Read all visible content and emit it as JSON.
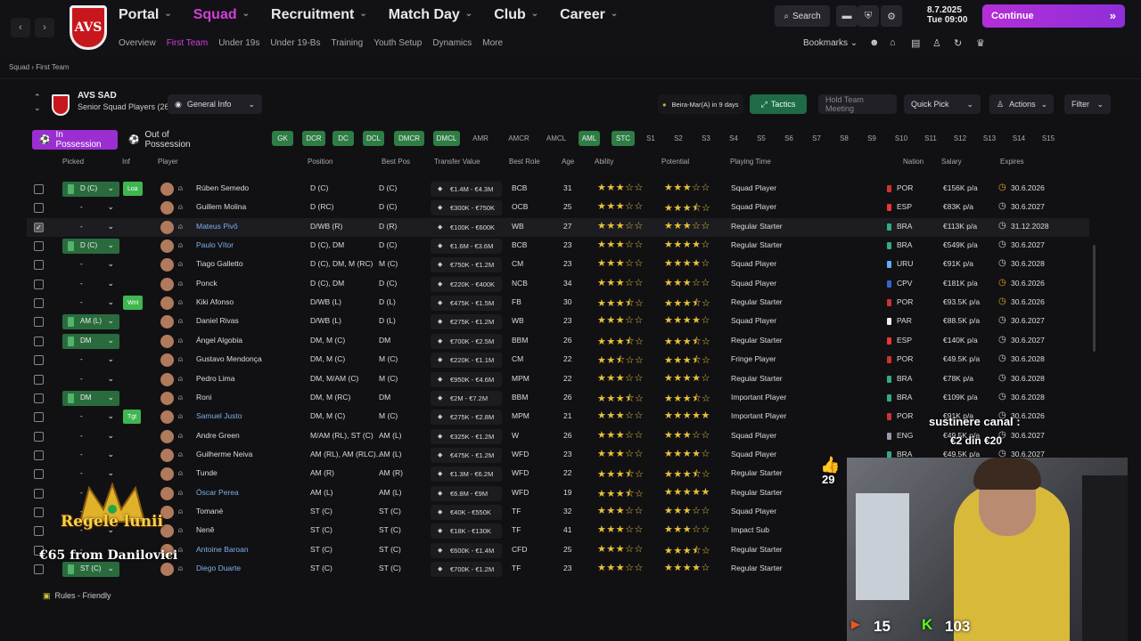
{
  "nav": {
    "back": "‹",
    "forward": "›",
    "crest": "AVS",
    "items": [
      "Portal",
      "Squad",
      "Recruitment",
      "Match Day",
      "Club",
      "Career"
    ],
    "active": "Squad",
    "sub": [
      "Overview",
      "First Team",
      "Under 19s",
      "Under 19-Bs",
      "Training",
      "Youth Setup",
      "Dynamics",
      "More"
    ],
    "sub_active": "First Team"
  },
  "topbar": {
    "search": "Search",
    "date_line1": "8.7.2025",
    "date_line2": "Tue 09:00",
    "continue": "Continue",
    "bookmarks": "Bookmarks"
  },
  "breadcrumb": "Squad › First Team",
  "club": {
    "name": "AVS SAD",
    "subtitle": "Senior Squad Players (26)",
    "view": "General Info",
    "next_match": "Beira-Mar(A) in 9 days",
    "tactics": "Tactics",
    "meeting": "Hold Team Meeting",
    "quick_pick": "Quick Pick",
    "actions": "Actions",
    "filter": "Filter"
  },
  "tabs": {
    "in": "In Possession",
    "out": "Out of Possession"
  },
  "positions": [
    {
      "l": "GK",
      "on": true
    },
    {
      "l": "DCR",
      "on": true
    },
    {
      "l": "DC",
      "on": true
    },
    {
      "l": "DCL",
      "on": true
    },
    {
      "l": "DMCR",
      "on": true
    },
    {
      "l": "DMCL",
      "on": true
    },
    {
      "l": "AMR",
      "on": false
    },
    {
      "l": "AMCR",
      "on": false
    },
    {
      "l": "AMCL",
      "on": false
    },
    {
      "l": "AML",
      "on": true
    },
    {
      "l": "STC",
      "on": true
    },
    {
      "l": "S1",
      "on": false
    },
    {
      "l": "S2",
      "on": false
    },
    {
      "l": "S3",
      "on": false
    },
    {
      "l": "S4",
      "on": false
    },
    {
      "l": "S5",
      "on": false
    },
    {
      "l": "S6",
      "on": false
    },
    {
      "l": "S7",
      "on": false
    },
    {
      "l": "S8",
      "on": false
    },
    {
      "l": "S9",
      "on": false
    },
    {
      "l": "S10",
      "on": false
    },
    {
      "l": "S11",
      "on": false
    },
    {
      "l": "S12",
      "on": false
    },
    {
      "l": "S13",
      "on": false
    },
    {
      "l": "S14",
      "on": false
    },
    {
      "l": "S15",
      "on": false
    }
  ],
  "columns": [
    "Picked",
    "Inf",
    "Player",
    "Position",
    "Best Pos",
    "Transfer Value",
    "Best Role",
    "Age",
    "Ability",
    "Potential",
    "Playing Time",
    "Nation",
    "Salary",
    "Expires"
  ],
  "rows": [
    {
      "pick": "D (C)",
      "inf": "Loa",
      "name": "Rúben Semedo",
      "pos": "D (C)",
      "best": "D (C)",
      "tv": "€1.4M - €4.3M",
      "role": "BCB",
      "age": "31",
      "ab": 3,
      "pot": 3,
      "pt": "Squad Player",
      "nat": "POR",
      "nc": "#c33",
      "sal": "€156K p/a",
      "exp": "30.6.2026",
      "ec": "#e0a020",
      "link": false
    },
    {
      "pick": "-",
      "inf": "",
      "name": "Guillem Molina",
      "pos": "D (RC)",
      "best": "D (C)",
      "tv": "€300K - €750K",
      "role": "OCB",
      "age": "25",
      "ab": 3,
      "pot": 3.5,
      "pt": "Squad Player",
      "nat": "ESP",
      "nc": "#e33",
      "sal": "€83K p/a",
      "exp": "30.6.2027",
      "ec": "#ccc",
      "link": false
    },
    {
      "pick": "-",
      "inf": "",
      "name": "Mateus Pivô",
      "pos": "D/WB (R)",
      "best": "D (R)",
      "tv": "€100K - €600K",
      "role": "WB",
      "age": "27",
      "ab": 3,
      "pot": 3,
      "pt": "Regular Starter",
      "nat": "BRA",
      "nc": "#3a8",
      "sal": "€113K p/a",
      "exp": "31.12.2028",
      "ec": "#ccc",
      "link": true,
      "sel": true
    },
    {
      "pick": "D (C)",
      "inf": "",
      "name": "Paulo Vítor",
      "pos": "D (C), DM",
      "best": "D (C)",
      "tv": "€1.6M - €3.6M",
      "role": "BCB",
      "age": "23",
      "ab": 3,
      "pot": 4,
      "pt": "Regular Starter",
      "nat": "BRA",
      "nc": "#3a8",
      "sal": "€549K p/a",
      "exp": "30.6.2027",
      "ec": "#ccc",
      "link": true
    },
    {
      "pick": "-",
      "inf": "",
      "name": "Tiago Galletto",
      "pos": "D (C), DM, M (RC)",
      "best": "M (C)",
      "tv": "€750K - €1.2M",
      "role": "CM",
      "age": "23",
      "ab": 3,
      "pot": 4,
      "pt": "Squad Player",
      "nat": "URU",
      "nc": "#6af",
      "sal": "€91K p/a",
      "exp": "30.6.2028",
      "ec": "#ccc",
      "link": false
    },
    {
      "pick": "-",
      "inf": "",
      "name": "Ponck",
      "pos": "D (C), DM",
      "best": "D (C)",
      "tv": "€220K - €400K",
      "role": "NCB",
      "age": "34",
      "ab": 3,
      "pot": 3,
      "pt": "Squad Player",
      "nat": "CPV",
      "nc": "#36c",
      "sal": "€181K p/a",
      "exp": "30.6.2026",
      "ec": "#e0a020",
      "link": false
    },
    {
      "pick": "-",
      "inf": "Wnt",
      "name": "Kiki Afonso",
      "pos": "D/WB (L)",
      "best": "D (L)",
      "tv": "€475K - €1.5M",
      "role": "FB",
      "age": "30",
      "ab": 3.5,
      "pot": 3.5,
      "pt": "Regular Starter",
      "nat": "POR",
      "nc": "#c33",
      "sal": "€93.5K p/a",
      "exp": "30.6.2026",
      "ec": "#e0a020",
      "link": false
    },
    {
      "pick": "AM (L)",
      "inf": "",
      "name": "Daniel Rivas",
      "pos": "D/WB (L)",
      "best": "D (L)",
      "tv": "€275K - €1.2M",
      "role": "WB",
      "age": "23",
      "ab": 3,
      "pot": 4,
      "pt": "Squad Player",
      "nat": "PAR",
      "nc": "#eee",
      "sal": "€88.5K p/a",
      "exp": "30.6.2027",
      "ec": "#ccc",
      "link": false
    },
    {
      "pick": "DM",
      "inf": "",
      "name": "Ángel Algobia",
      "pos": "DM, M (C)",
      "best": "DM",
      "tv": "€700K - €2.5M",
      "role": "BBM",
      "age": "26",
      "ab": 3.5,
      "pot": 3.5,
      "pt": "Regular Starter",
      "nat": "ESP",
      "nc": "#e33",
      "sal": "€140K p/a",
      "exp": "30.6.2027",
      "ec": "#ccc",
      "link": false
    },
    {
      "pick": "-",
      "inf": "",
      "name": "Gustavo Mendonça",
      "pos": "DM, M (C)",
      "best": "M (C)",
      "tv": "€220K - €1.1M",
      "role": "CM",
      "age": "22",
      "ab": 2.5,
      "pot": 3.5,
      "pt": "Fringe Player",
      "nat": "POR",
      "nc": "#c33",
      "sal": "€49.5K p/a",
      "exp": "30.6.2028",
      "ec": "#ccc",
      "link": false
    },
    {
      "pick": "-",
      "inf": "",
      "name": "Pedro Lima",
      "pos": "DM, M/AM (C)",
      "best": "M (C)",
      "tv": "€950K - €4.6M",
      "role": "MPM",
      "age": "22",
      "ab": 3,
      "pot": 4,
      "pt": "Regular Starter",
      "nat": "BRA",
      "nc": "#3a8",
      "sal": "€78K p/a",
      "exp": "30.6.2028",
      "ec": "#ccc",
      "link": false
    },
    {
      "pick": "DM",
      "inf": "",
      "name": "Roni",
      "pos": "DM, M (RC)",
      "best": "DM",
      "tv": "€2M - €7.2M",
      "role": "BBM",
      "age": "26",
      "ab": 3.5,
      "pot": 3.5,
      "pt": "Important Player",
      "nat": "BRA",
      "nc": "#3a8",
      "sal": "€109K p/a",
      "exp": "30.6.2028",
      "ec": "#ccc",
      "link": false
    },
    {
      "pick": "-",
      "inf": "Tgt",
      "name": "Samuel Justo",
      "pos": "DM, M (C)",
      "best": "M (C)",
      "tv": "€275K - €2.8M",
      "role": "MPM",
      "age": "21",
      "ab": 3,
      "pot": 5,
      "pt": "Important Player",
      "nat": "POR",
      "nc": "#c33",
      "sal": "€91K p/a",
      "exp": "30.6.2026",
      "ec": "#ccc",
      "link": true
    },
    {
      "pick": "-",
      "inf": "",
      "name": "Andre Green",
      "pos": "M/AM (RL), ST (C)",
      "best": "AM (L)",
      "tv": "€325K - €1.2M",
      "role": "W",
      "age": "26",
      "ab": 3,
      "pot": 3,
      "pt": "Squad Player",
      "nat": "ENG",
      "nc": "#99a",
      "sal": "€49.5K p/a",
      "exp": "30.6.2027",
      "ec": "#ccc",
      "link": false
    },
    {
      "pick": "-",
      "inf": "",
      "name": "Guilherme Neiva",
      "pos": "AM (RL), AM (RLC)...",
      "best": "AM (L)",
      "tv": "€475K - €1.2M",
      "role": "WFD",
      "age": "23",
      "ab": 3,
      "pot": 4,
      "pt": "Squad Player",
      "nat": "BRA",
      "nc": "#3a8",
      "sal": "€49.5K p/a",
      "exp": "30.6.2027",
      "ec": "#ccc",
      "link": false
    },
    {
      "pick": "-",
      "inf": "",
      "name": "Tunde",
      "pos": "AM (R)",
      "best": "AM (R)",
      "tv": "€1.3M - €6.2M",
      "role": "WFD",
      "age": "22",
      "ab": 3.5,
      "pot": 3.5,
      "pt": "Regular Starter",
      "nat": "",
      "nc": "#999",
      "sal": "",
      "exp": "",
      "ec": "#ccc",
      "link": false
    },
    {
      "pick": "-",
      "inf": "",
      "name": "Óscar Perea",
      "pos": "AM (L)",
      "best": "AM (L)",
      "tv": "€6.8M - €9M",
      "role": "WFD",
      "age": "19",
      "ab": 3.5,
      "pot": 5,
      "pt": "Regular Starter",
      "nat": "",
      "nc": "#999",
      "sal": "",
      "exp": "",
      "ec": "#ccc",
      "link": true
    },
    {
      "pick": "-",
      "inf": "",
      "name": "Tomané",
      "pos": "ST (C)",
      "best": "ST (C)",
      "tv": "€40K - €550K",
      "role": "TF",
      "age": "32",
      "ab": 3,
      "pot": 3,
      "pt": "Squad Player",
      "nat": "",
      "nc": "#999",
      "sal": "",
      "exp": "",
      "ec": "#ccc",
      "link": false
    },
    {
      "pick": "-",
      "inf": "",
      "name": "Nenê",
      "pos": "ST (C)",
      "best": "ST (C)",
      "tv": "€18K - €130K",
      "role": "TF",
      "age": "41",
      "ab": 3,
      "pot": 3,
      "pt": "Impact Sub",
      "nat": "",
      "nc": "#999",
      "sal": "",
      "exp": "",
      "ec": "#ccc",
      "link": false
    },
    {
      "pick": "-",
      "inf": "",
      "name": "Antoine Baroan",
      "pos": "ST (C)",
      "best": "ST (C)",
      "tv": "€600K - €1.4M",
      "role": "CFD",
      "age": "25",
      "ab": 3,
      "pot": 3.5,
      "pt": "Regular Starter",
      "nat": "",
      "nc": "#999",
      "sal": "",
      "exp": "",
      "ec": "#ccc",
      "link": true
    },
    {
      "pick": "ST (C)",
      "inf": "",
      "name": "Diego Duarte",
      "pos": "ST (C)",
      "best": "ST (C)",
      "tv": "€700K - €1.2M",
      "role": "TF",
      "age": "23",
      "ab": 3,
      "pot": 4,
      "pt": "Regular Starter",
      "nat": "",
      "nc": "#999",
      "sal": "",
      "exp": "",
      "ec": "#ccc",
      "link": true
    }
  ],
  "rules": "Rules - Friendly",
  "overlay": {
    "goal_title": "sustinere canal :",
    "goal_sub": "€2 din €20",
    "likes": "29",
    "king_title": "Regele lunii",
    "king_sub": "€65 from Danilovici",
    "yt": "15",
    "kick": "103"
  }
}
